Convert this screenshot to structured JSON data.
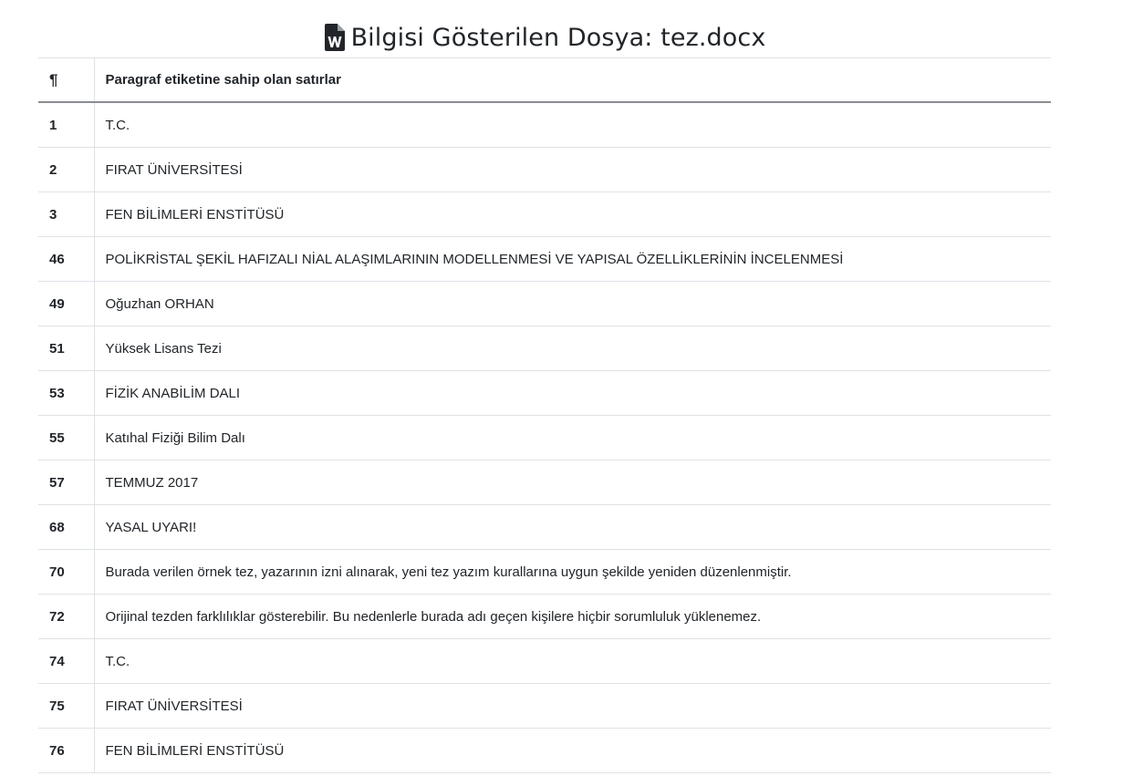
{
  "header": {
    "title": "Bilgisi Gösterilen Dosya: tez.docx",
    "icon": "word-file-icon"
  },
  "table": {
    "columns": [
      "¶",
      "Paragraf etiketine sahip olan satırlar"
    ],
    "rows": [
      {
        "num": "1",
        "text": "T.C."
      },
      {
        "num": "2",
        "text": "FIRAT ÜNİVERSİTESİ"
      },
      {
        "num": "3",
        "text": "FEN BİLİMLERİ ENSTİTÜSÜ"
      },
      {
        "num": "46",
        "text": "POLİKRİSTAL ŞEKİL HAFIZALI NİAL ALAŞIMLARININ MODELLENMESİ VE YAPISAL ÖZELLİKLERİNİN İNCELENMESİ"
      },
      {
        "num": "49",
        "text": "Oğuzhan ORHAN"
      },
      {
        "num": "51",
        "text": "Yüksek Lisans Tezi"
      },
      {
        "num": "53",
        "text": "FİZİK ANABİLİM DALI"
      },
      {
        "num": "55",
        "text": "Katıhal Fiziği Bilim Dalı"
      },
      {
        "num": "57",
        "text": "TEMMUZ 2017"
      },
      {
        "num": "68",
        "text": "YASAL UYARI!"
      },
      {
        "num": "70",
        "text": "Burada verilen örnek tez, yazarının izni alınarak, yeni tez yazım kurallarına uygun şekilde yeniden düzenlenmiştir."
      },
      {
        "num": "72",
        "text": "Orijinal tezden farklılıklar gösterebilir. Bu nedenlerle burada adı geçen kişilere hiçbir sorumluluk yüklenemez."
      },
      {
        "num": "74",
        "text": "T.C."
      },
      {
        "num": "75",
        "text": "FIRAT ÜNİVERSİTESİ"
      },
      {
        "num": "76",
        "text": "FEN BİLİMLERİ ENSTİTÜSÜ"
      }
    ]
  }
}
